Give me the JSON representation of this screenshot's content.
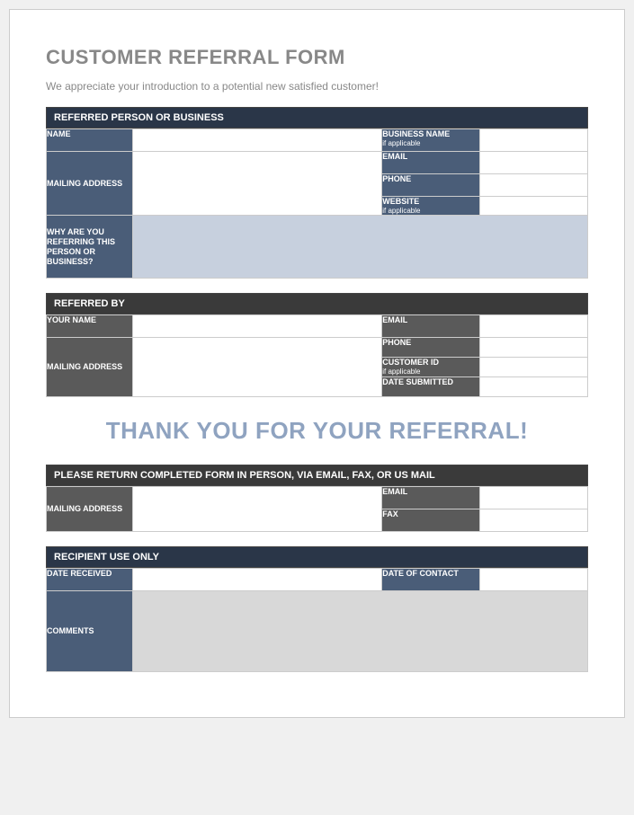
{
  "title": "CUSTOMER REFERRAL FORM",
  "subtitle": "We appreciate your introduction to a potential new satisfied customer!",
  "section1": {
    "header": "REFERRED PERSON OR BUSINESS",
    "name": "NAME",
    "mailing": "MAILING ADDRESS",
    "business": "BUSINESS NAME",
    "business_sub": "if applicable",
    "email": "EMAIL",
    "phone": "PHONE",
    "website": "WEBSITE",
    "website_sub": "if applicable",
    "why": "WHY ARE YOU REFERRING THIS PERSON OR BUSINESS?"
  },
  "section2": {
    "header": "REFERRED BY",
    "yourname": "YOUR NAME",
    "mailing": "MAILING ADDRESS",
    "email": "EMAIL",
    "phone": "PHONE",
    "custid": "CUSTOMER ID",
    "custid_sub": "if applicable",
    "date": "DATE SUBMITTED"
  },
  "thankyou": "THANK YOU FOR YOUR REFERRAL!",
  "section3": {
    "header": "PLEASE RETURN COMPLETED FORM IN PERSON, VIA EMAIL, FAX, OR US MAIL",
    "mailing": "MAILING ADDRESS",
    "email": "EMAIL",
    "fax": "FAX"
  },
  "section4": {
    "header": "RECIPIENT USE ONLY",
    "received": "DATE RECEIVED",
    "contact": "DATE OF CONTACT",
    "comments": "COMMENTS"
  }
}
